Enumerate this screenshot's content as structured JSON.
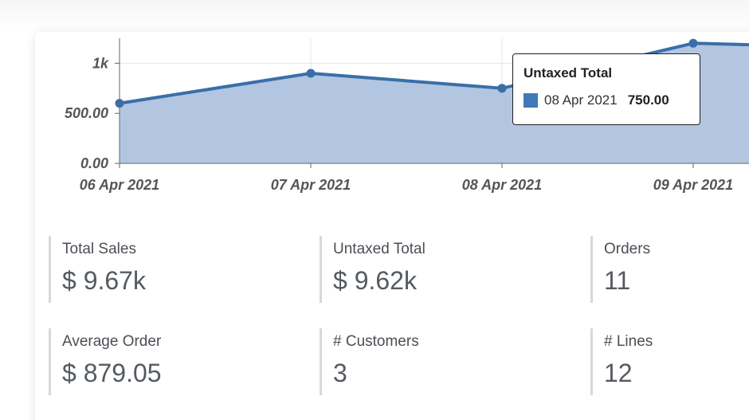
{
  "chart_data": {
    "type": "area",
    "categories": [
      "06 Apr 2021",
      "07 Apr 2021",
      "08 Apr 2021",
      "09 Apr 2021",
      ""
    ],
    "values": [
      600,
      900,
      750,
      1200,
      1150
    ],
    "yticks": [
      "0.00",
      "500.00",
      "1k"
    ],
    "ylim": [
      0,
      1250
    ],
    "grid": true,
    "colors": {
      "line": "#3a6ea8",
      "fill": "#aec3df"
    },
    "tooltip": {
      "title": "Untaxed Total",
      "date": "08 Apr 2021",
      "value": "750.00",
      "swatch_color": "#4178b8"
    }
  },
  "kpis": [
    {
      "label": "Total Sales",
      "value": "$ 9.67k"
    },
    {
      "label": "Untaxed Total",
      "value": "$ 9.62k"
    },
    {
      "label": "Orders",
      "value": "11"
    },
    {
      "label": "Average Order",
      "value": "$ 879.05"
    },
    {
      "label": "# Customers",
      "value": "3"
    },
    {
      "label": "# Lines",
      "value": "12"
    }
  ]
}
